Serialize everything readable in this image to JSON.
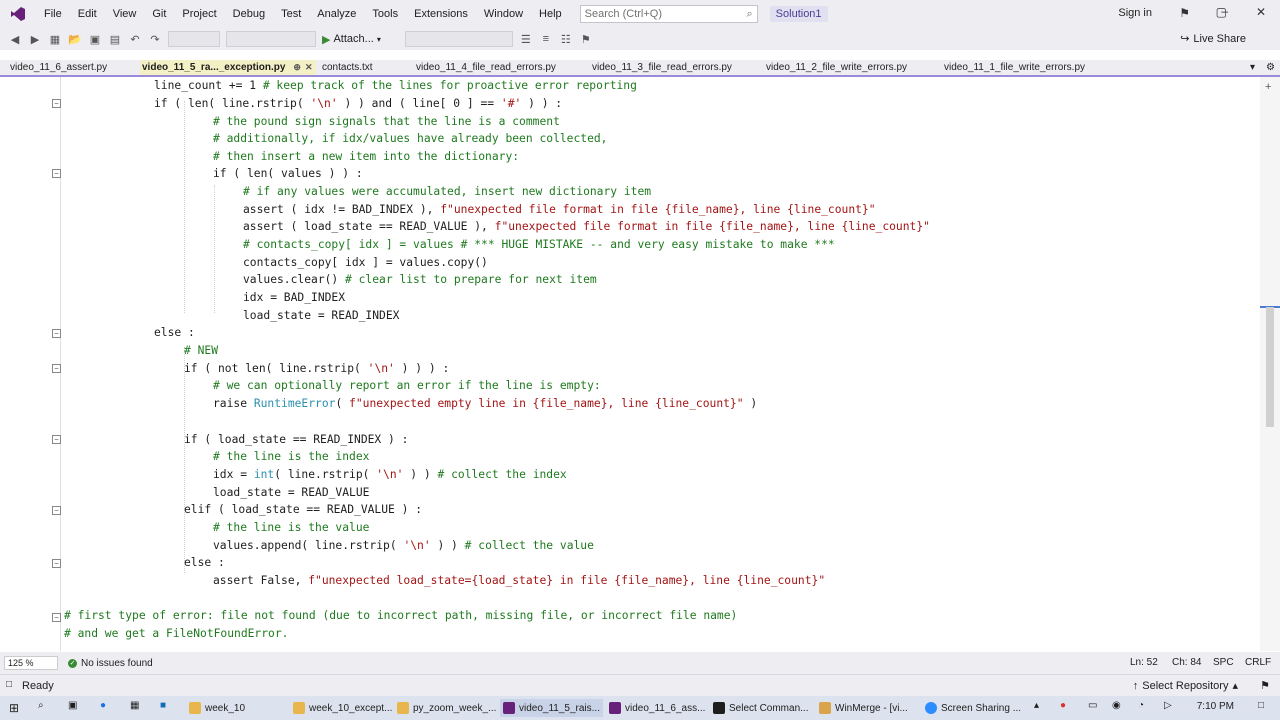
{
  "menubar": {
    "items": [
      "File",
      "Edit",
      "View",
      "Git",
      "Project",
      "Debug",
      "Test",
      "Analyze",
      "Tools",
      "Extensions",
      "Window",
      "Help"
    ],
    "search_placeholder": "Search (Ctrl+Q)",
    "solution": "Solution1",
    "sign_in": "Sign in"
  },
  "toolbar": {
    "attach_label": "Attach...",
    "live_share": "Live Share"
  },
  "tabs": [
    "video_11_6_assert.py",
    "video_11_5_ra..._exception.py",
    "contacts.txt",
    "video_11_4_file_read_errors.py",
    "video_11_3_file_read_errors.py",
    "video_11_2_file_write_errors.py",
    "video_11_1_file_write_errors.py"
  ],
  "code": {
    "l1": "line_count += 1 ",
    "l1c": "# keep track of the lines for proactive error reporting",
    "l2": "if ( len( line.rstrip( ",
    "l2s": "'\\n'",
    "l2b": " ) ) and ( line[ 0 ] == ",
    "l2s2": "'#'",
    "l2e": " ) ) :",
    "l3": "# the pound sign signals that the line is a comment",
    "l4": "# additionally, if idx/values have already been collected,",
    "l5": "# then insert a new item into the dictionary:",
    "l6": "if ( len( values ) ) :",
    "l7": "# if any values were accumulated, insert new dictionary item",
    "l8a": "assert ( idx != BAD_INDEX ), ",
    "l8s": "f\"unexpected file format in file {file_name}, line {line_count}\"",
    "l9a": "assert ( load_state == READ_VALUE ), ",
    "l9s": "f\"unexpected file format in file {file_name}, line {line_count}\"",
    "l10": "# contacts_copy[ idx ] = values # *** HUGE MISTAKE -- and very easy mistake to make ***",
    "l11": "contacts_copy[ idx ] = values.copy()",
    "l12a": "values.clear() ",
    "l12c": "# clear list to prepare for next item",
    "l13": "idx = BAD_INDEX",
    "l14": "load_state = READ_INDEX",
    "l15": "else :",
    "l16": "# NEW",
    "l17a": "if ( not len( line.rstrip( ",
    "l17s": "'\\n'",
    "l17e": " ) ) ) :",
    "l18": "# we can optionally report an error if the line is empty:",
    "l19a": "raise ",
    "l19b": "RuntimeError",
    "l19c": "( ",
    "l19s": "f\"unexpected empty line in {file_name}, line {line_count}\"",
    "l19e": " )",
    "l20": "if ( load_state == READ_INDEX ) :",
    "l21": "# the line is the index",
    "l22a": "idx = ",
    "l22b": "int",
    "l22c": "( line.rstrip( ",
    "l22s": "'\\n'",
    "l22d": " ) ) ",
    "l22cm": "# collect the index",
    "l23": "load_state = READ_VALUE",
    "l24": "elif ( load_state == READ_VALUE ) :",
    "l25": "# the line is the value",
    "l26a": "values.append( line.rstrip( ",
    "l26s": "'\\n'",
    "l26b": " ) ) ",
    "l26cm": "# collect the value",
    "l27": "else :",
    "l28a": "assert False, ",
    "l28s": "f\"unexpected load_state={load_state} in file {file_name}, line {line_count}\"",
    "l29": "# first type of error: file not found (due to incorrect path, missing file, or incorrect file name)",
    "l30": "# and we get a FileNotFoundError."
  },
  "editor_status": {
    "zoom": "125 %",
    "issues": "No issues found",
    "ln": "Ln: 52",
    "ch": "Ch: 84",
    "spc": "SPC",
    "crlf": "CRLF"
  },
  "statusbar": {
    "ready": "Ready",
    "select_repo": "Select Repository"
  },
  "taskbar": {
    "items": [
      "week_10",
      "week_10_except...",
      "py_zoom_week_...",
      "video_11_5_rais...",
      "video_11_6_ass...",
      "Select Comman...",
      "WinMerge - [vi...",
      "Screen Sharing ..."
    ],
    "clock": "7:10 PM"
  },
  "colors": {
    "accent": "#68217a",
    "comment": "#1f7a1f",
    "string": "#a31515",
    "builtin": "#2b91af",
    "active_tab": "#f4f0c6"
  }
}
